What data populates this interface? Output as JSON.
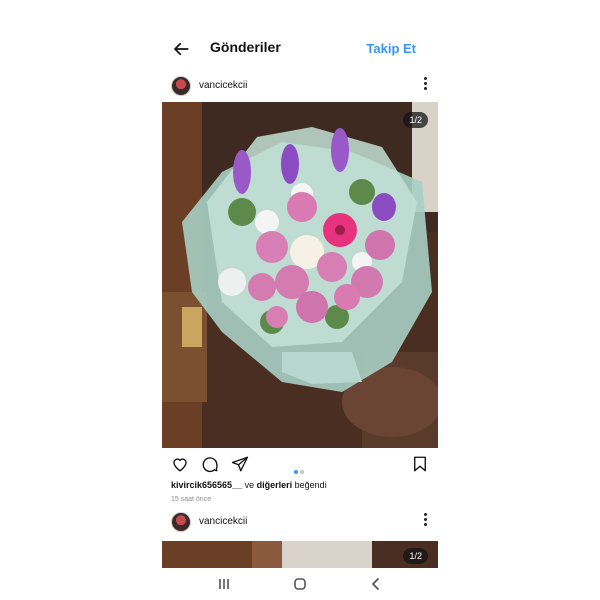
{
  "header": {
    "title": "Gönderiler",
    "follow_label": "Takip Et"
  },
  "posts": [
    {
      "username": "vancicekcii",
      "counter": "1/2"
    },
    {
      "username": "vancicekcii",
      "counter": "1/2"
    }
  ],
  "likes": {
    "user": "kivircik656565__",
    "connector": "ve",
    "others": "diğerleri",
    "suffix": "beğendi"
  },
  "time": "15 saat önce",
  "carousel": {
    "count": 2,
    "active": 1
  },
  "icons": {
    "back": "arrow-left-icon",
    "more": "more-vertical-icon",
    "like": "heart-icon",
    "comment": "comment-icon",
    "share": "send-icon",
    "save": "bookmark-icon",
    "nav_recent": "recent-apps-icon",
    "nav_home": "home-icon",
    "nav_back": "chevron-left-icon"
  },
  "colors": {
    "accent": "#3897f0",
    "text": "#111111",
    "muted": "#8e8e8e"
  }
}
